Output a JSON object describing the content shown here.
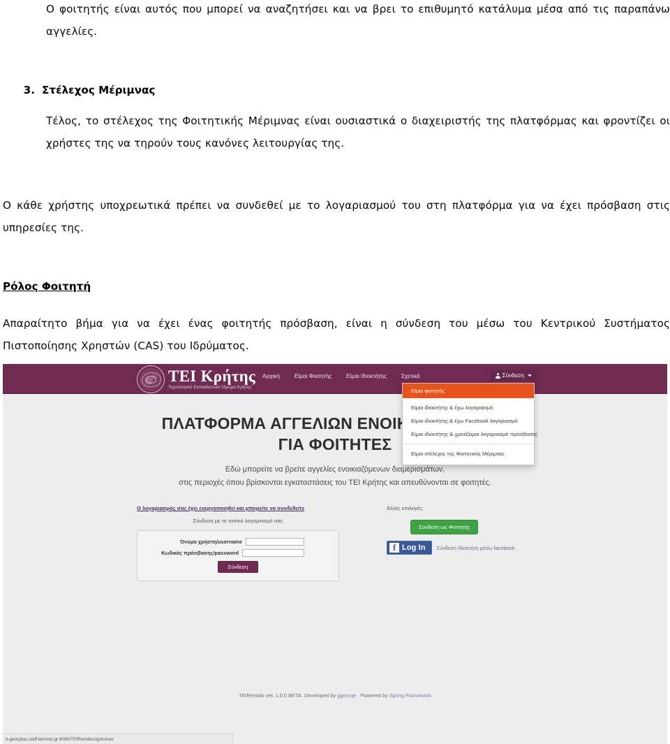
{
  "document": {
    "intro_paragraph": "Ο φοιτητής είναι αυτός που μπορεί να αναζητήσει και να βρει το επιθυμητό κατάλυμα μέσα από τις παραπάνω αγγελίες.",
    "list_number": "3.",
    "list_label": "Στέλεχος Μέριμνας",
    "body_paragraph_1": "Τέλος, το στέλεχος της Φοιτητικής Μέριμνας είναι ουσιαστικά ο διαχειριστής της πλατφόρμας και φροντίζει οι χρήστες της να τηρούν τους κανόνες λειτουργίας της.",
    "body_paragraph_2": "Ο κάθε χρήστης υποχρεωτικά πρέπει να συνδεθεί με το λογαριασμού του στη πλατφόρμα για να έχει πρόσβαση στις υπηρεσίες της.",
    "section_heading": "Ρόλος Φοιτητή",
    "body_paragraph_3": "Απαραίτητο βήμα για να έχει ένας φοιτητής πρόσβαση, είναι η σύνδεση του μέσω του Κεντρικού Συστήματος Πιστοποίησης Χρηστών (CAS) του Ιδρύματος."
  },
  "screenshot": {
    "navbar": {
      "brand_title": "ΤΕΙ Κρήτης",
      "brand_subtitle": "Τεχνολογικό Εκπαιδευτικό Ίδρυμα Κρήτης",
      "emblem_icon": "tei-crete-emblem-icon",
      "links": [
        {
          "label": "Αρχική"
        },
        {
          "label": "Είμαι Φοιτητής"
        },
        {
          "label": "Είμαι Ιδιοκτήτης"
        },
        {
          "label": "Σχετικά"
        }
      ],
      "login_menu_label": "Σύνδεση",
      "login_user_icon": "user-icon",
      "caret_icon": "caret-down-icon"
    },
    "dropdown": {
      "active_item": "Είμαι φοιτητής",
      "items": [
        {
          "label": "Είμαι ιδιοκτήτης & έχω λογαριασμό"
        },
        {
          "label": "Είμαι ιδιοκτήτης & έχω Facebook λογαριασμό"
        },
        {
          "label": "Είμαι ιδιοκτήτης & χρειάζομαι λογαριασμό πρόσβασης"
        }
      ],
      "staff_item": "Είμαι στέλεχος της Φοιτητικής Μέριμνας"
    },
    "hero": {
      "title_line1": "ΠΛΑΤΦΟΡΜΑ ΑΓΓΕΛΙΩΝ ΕΝΟΙΚΙΑΖΟΜΕΝΩΝ",
      "title_line2": "ΓΙΑ ΦΟΙΤΗΤΕΣ",
      "subtitle_line1": "Εδώ μπορείτε να βρείτε αγγελίες ενοικιαζόμενων διαμερισμάτων,",
      "subtitle_line2": "στις περιοχές όπου βρίσκονται εγκαταστάσεις του ΤΕΙ Κρήτης και απευθύνονται σε φοιτητές."
    },
    "login": {
      "activated_notice": "Ο λογαριασμός σας έχει ενεργοποιηθεί και μπορείτε να συνδεθείτε",
      "local_login_title": "Σύνδεση με το τοπικό λογαριασμό σας",
      "username_label": "Όνομα χρήστη/username",
      "username_value": "",
      "password_label": "Κωδικός πρόσβασης/password",
      "password_value": "",
      "submit_label": "Σύνδεση"
    },
    "other_options": {
      "title": "Άλλες επιλογές:",
      "student_button": "Σύνδεση ως Φοιτητής",
      "facebook_button": "Log In",
      "facebook_icon": "facebook-f-icon",
      "facebook_text": "Σύνδεση Ιδιοκτήτη μέσω facebook"
    },
    "footer": {
      "prefix": "TEIRentals ver. 1.0.0 BETA. Developed by ",
      "developer": "ggeorge",
      "middle": " . Powered by ",
      "framework": "Spring Framework"
    },
    "statusbar": {
      "url": "it-georgilas.staff.teicrete.gr:8080/TEIRentals/signin/cas"
    }
  },
  "colors": {
    "brand_purple": "#702B52",
    "accent_orange": "#E8521B",
    "success_green": "#3EA345",
    "facebook_blue": "#3B5998",
    "page_background": "#EDEDED"
  }
}
